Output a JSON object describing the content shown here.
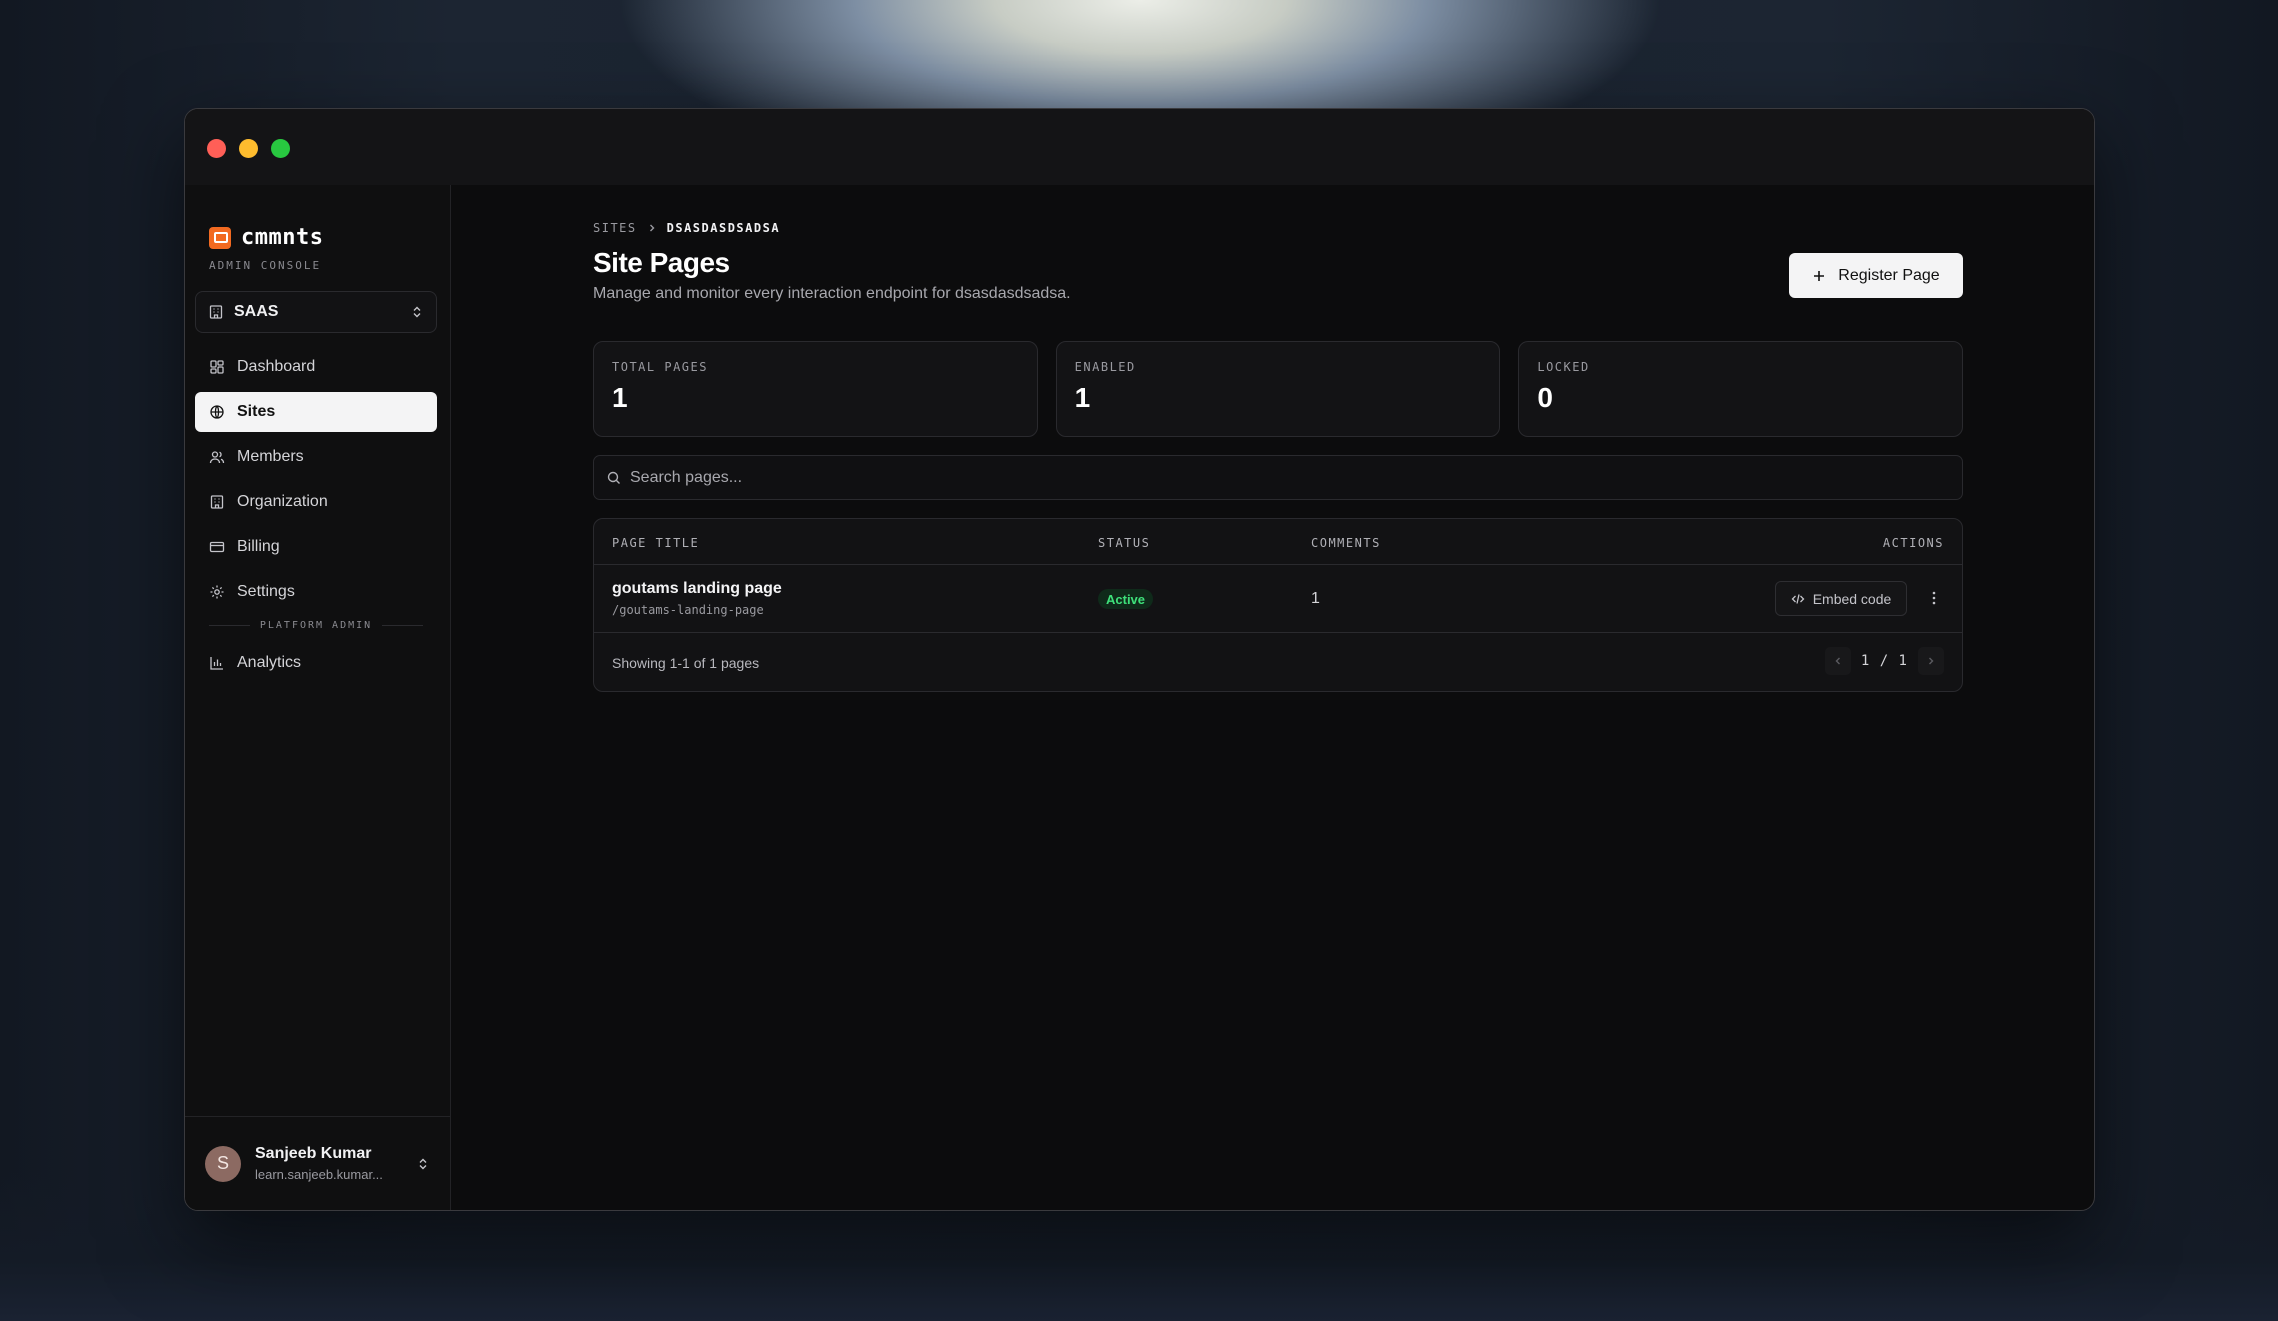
{
  "app": {
    "logo_text": "cmmnts",
    "subtitle": "ADMIN CONSOLE"
  },
  "org_switcher": {
    "name": "SAAS"
  },
  "sidebar": {
    "items": [
      {
        "label": "Dashboard",
        "icon": "dashboard-icon"
      },
      {
        "label": "Sites",
        "icon": "globe-icon",
        "active": true
      },
      {
        "label": "Members",
        "icon": "users-icon"
      },
      {
        "label": "Organization",
        "icon": "building-icon"
      },
      {
        "label": "Billing",
        "icon": "credit-card-icon"
      },
      {
        "label": "Settings",
        "icon": "gear-icon"
      }
    ],
    "section_label": "PLATFORM ADMIN",
    "admin_items": [
      {
        "label": "Analytics",
        "icon": "bar-chart-icon"
      }
    ]
  },
  "user": {
    "initial": "S",
    "name": "Sanjeeb Kumar",
    "email": "learn.sanjeeb.kumar..."
  },
  "breadcrumb": {
    "root": "SITES",
    "current": "DSASDASDSADSA"
  },
  "header": {
    "title": "Site Pages",
    "subtitle": "Manage and monitor every interaction endpoint for dsasdasdsadsa.",
    "register_label": "Register Page"
  },
  "stats": [
    {
      "label": "TOTAL PAGES",
      "value": "1"
    },
    {
      "label": "ENABLED",
      "value": "1"
    },
    {
      "label": "LOCKED",
      "value": "0"
    }
  ],
  "search": {
    "placeholder": "Search pages..."
  },
  "table": {
    "columns": [
      "PAGE TITLE",
      "STATUS",
      "COMMENTS",
      "ACTIONS"
    ],
    "rows": [
      {
        "title": "goutams landing page",
        "slug": "/goutams-landing-page",
        "status": "Active",
        "comments": "1",
        "embed_label": "Embed code"
      }
    ],
    "footer": {
      "showing": "Showing 1-1 of 1 pages",
      "pager": "1 / 1"
    }
  },
  "colors": {
    "accent": "#f26a21",
    "active_badge_text": "#3ee07a",
    "active_badge_bg": "#0f2a1a"
  }
}
